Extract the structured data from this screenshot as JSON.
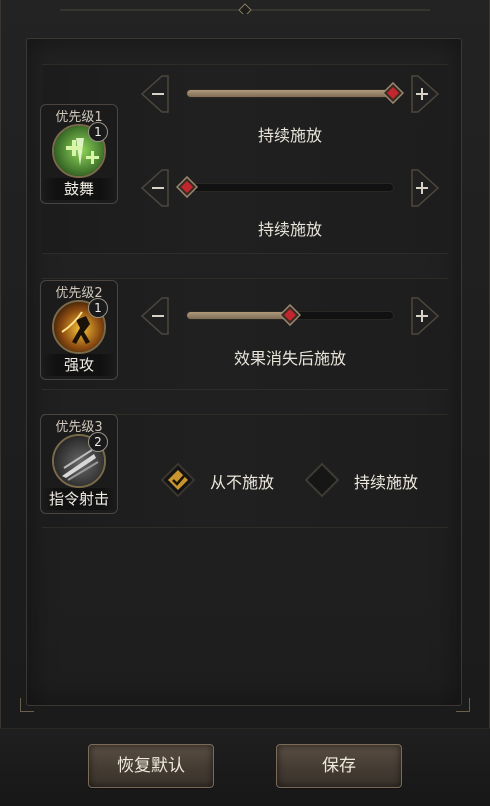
{
  "skills": [
    {
      "priority": "优先级1",
      "badge": "1",
      "name": "鼓舞"
    },
    {
      "priority": "优先级2",
      "badge": "1",
      "name": "强攻"
    },
    {
      "priority": "优先级3",
      "badge": "2",
      "name": "指令射击"
    }
  ],
  "sliders": [
    {
      "caption": "持续施放",
      "level": 1.0
    },
    {
      "caption": "持续施放",
      "level": 0.0
    },
    {
      "caption": "效果消失后施放",
      "level": 0.5
    }
  ],
  "options": [
    {
      "label": "从不施放",
      "selected": true
    },
    {
      "label": "持续施放",
      "selected": false
    }
  ],
  "buttons": {
    "reset_label": "恢复默认",
    "save_label": "保存"
  },
  "colors": {
    "accent_gold": "#c9952e",
    "thumb_red": "#c1272d",
    "track_fill": "#a08a6b"
  }
}
